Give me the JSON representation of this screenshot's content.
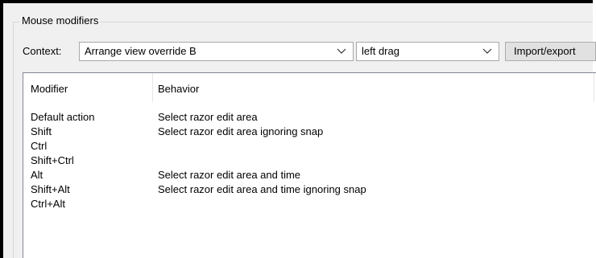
{
  "group": {
    "title": "Mouse modifiers"
  },
  "context": {
    "label": "Context:",
    "selected": "Arrange view override B",
    "action_selected": "left drag",
    "import_export_label": "Import/export"
  },
  "table": {
    "headers": [
      "Modifier",
      "Behavior"
    ],
    "rows": [
      {
        "modifier": "Default action",
        "behavior": "Select razor edit area"
      },
      {
        "modifier": "Shift",
        "behavior": "Select razor edit area ignoring snap"
      },
      {
        "modifier": "Ctrl",
        "behavior": ""
      },
      {
        "modifier": "Shift+Ctrl",
        "behavior": ""
      },
      {
        "modifier": "Alt",
        "behavior": "Select razor edit area and time"
      },
      {
        "modifier": "Shift+Alt",
        "behavior": "Select razor edit area and time ignoring snap"
      },
      {
        "modifier": "Ctrl+Alt",
        "behavior": ""
      }
    ]
  },
  "icons": {
    "dropdown": "chevron-down-icon"
  }
}
